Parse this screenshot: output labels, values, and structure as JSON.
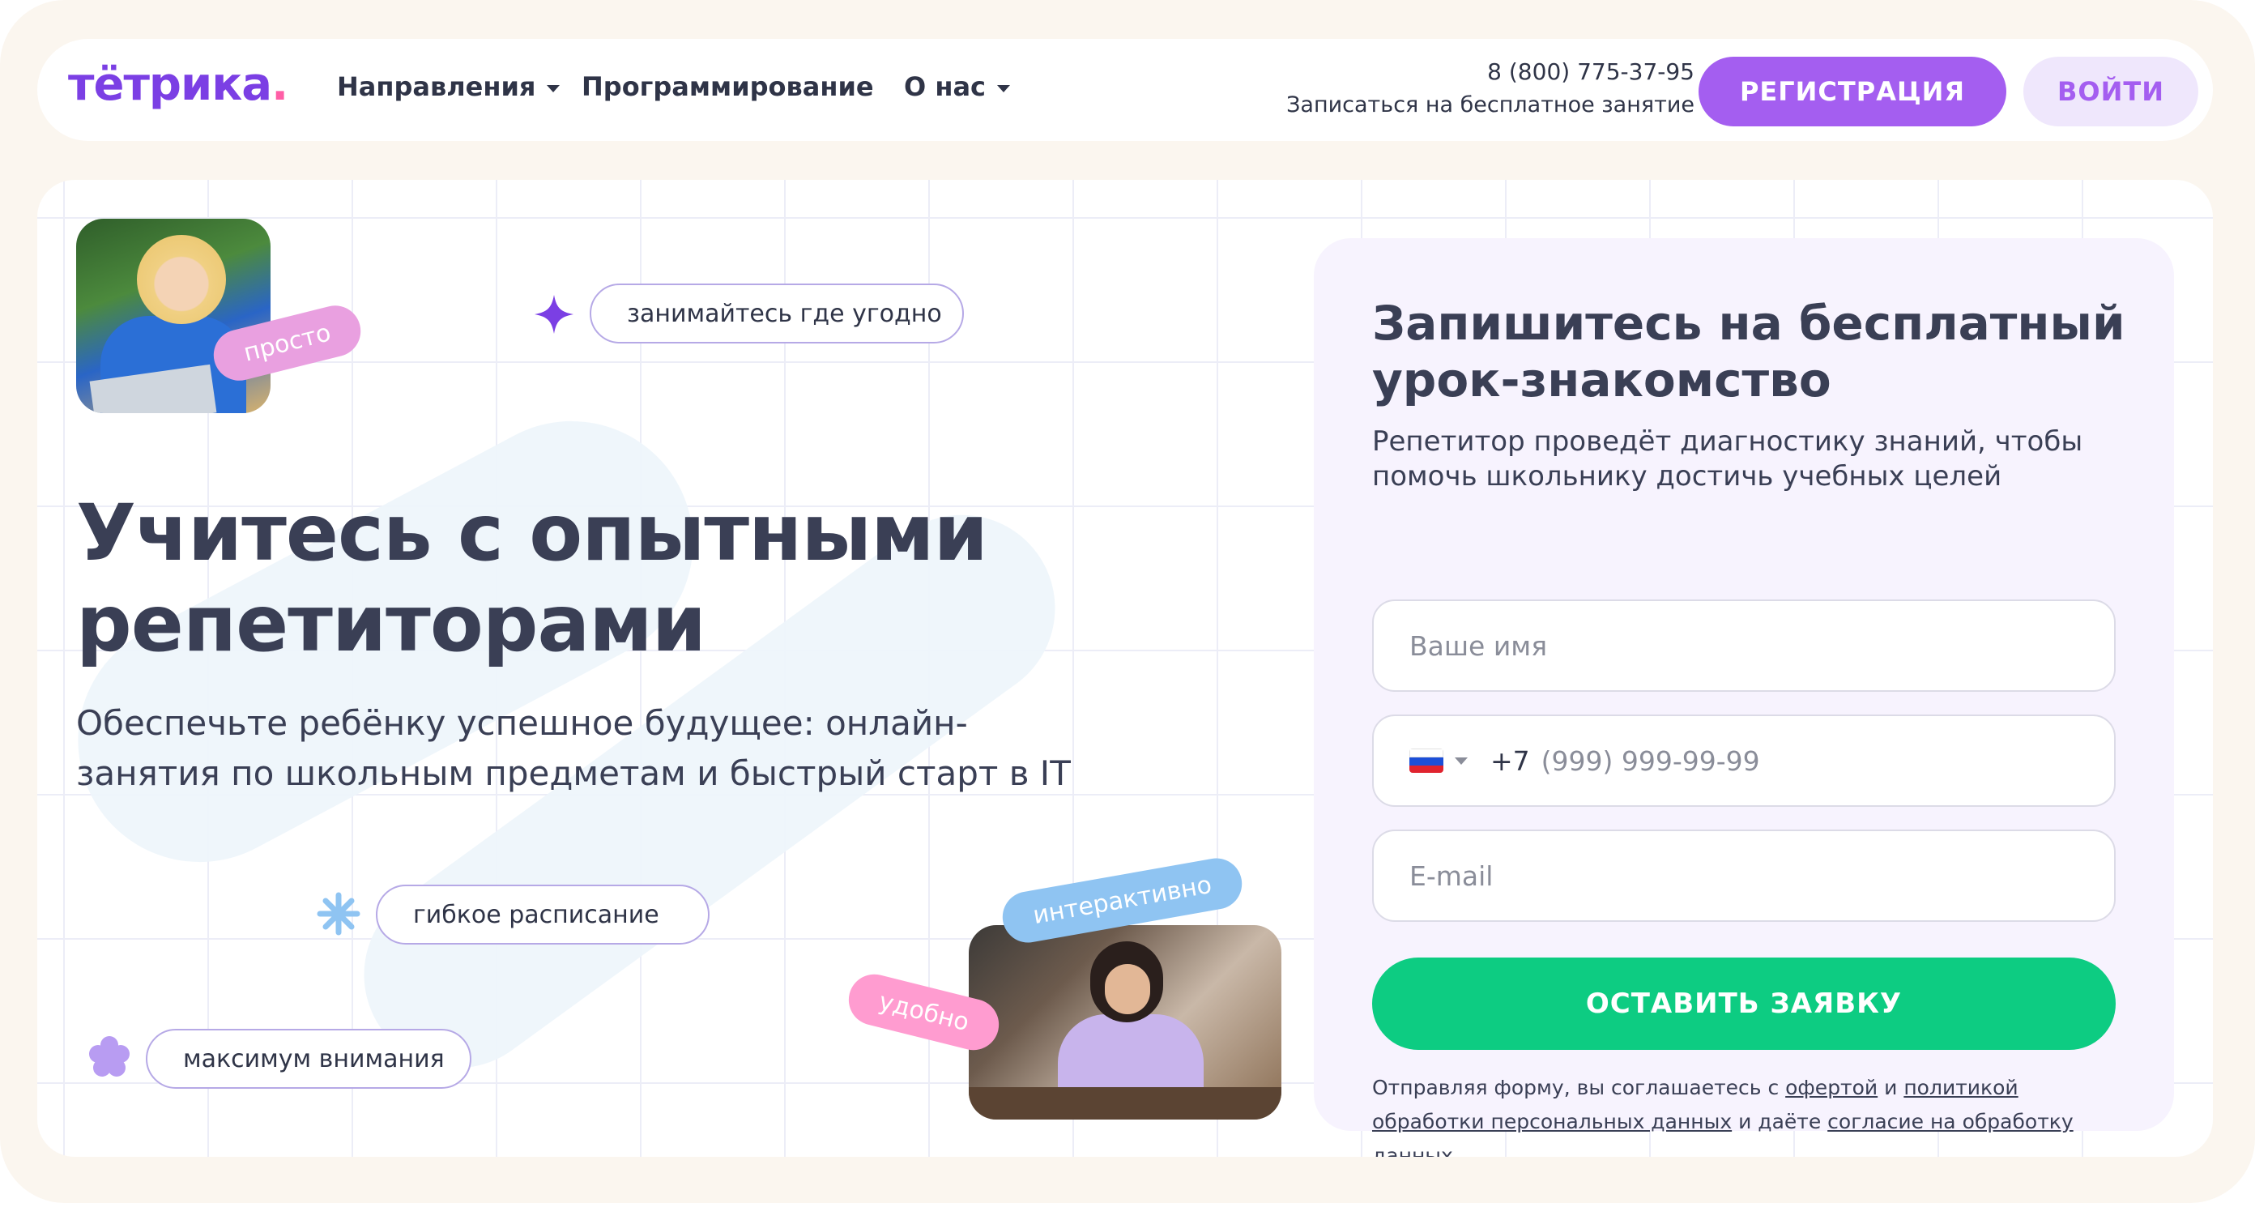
{
  "nav": {
    "logo_text": "тётрика",
    "logo_dot": ".",
    "items": [
      {
        "label": "Направления",
        "dropdown": true
      },
      {
        "label": "Программирование",
        "dropdown": false
      },
      {
        "label": "О нас",
        "dropdown": true
      }
    ],
    "phone": "8 (800) 775-37-95",
    "free_lesson_link": "Записаться на бесплатное занятие",
    "register_label": "РЕГИСТРАЦИЯ",
    "login_label": "ВОЙТИ"
  },
  "hero": {
    "title": "Учитесь с опытными репетиторами",
    "subtitle": "Обеспечьте ребёнку успешное будущее: онлайн-занятия по школьным предметам и быстрый старт в IT",
    "stickers": {
      "easy": "просто",
      "interactive": "интерактивно",
      "convenient": "удобно"
    },
    "pills": {
      "anywhere": "занимайтесь где угодно",
      "flexible": "гибкое расписание",
      "attention": "максимум внимания"
    }
  },
  "form": {
    "title": "Запишитесь на бесплатный урок-знакомство",
    "subtitle": "Репетитор проведёт диагностику знаний, чтобы помочь школьнику достичь учебных целей",
    "name_placeholder": "Ваше имя",
    "phone_code": "+7",
    "phone_placeholder": "(999) 999-99-99",
    "email_placeholder": "E-mail",
    "submit_label": "ОСТАВИТЬ ЗАЯВКУ",
    "legal": {
      "t1": "Отправляя форму, вы соглашаетесь с ",
      "offer": "офертой",
      "t2": " и ",
      "policy": "политикой обработки персональных данных",
      "t3": " и даёте ",
      "consent": "согласие на обработку данных"
    }
  },
  "colors": {
    "accent": "#a45ef0",
    "submit": "#0dcc82",
    "logo": "#7b3fe4"
  }
}
